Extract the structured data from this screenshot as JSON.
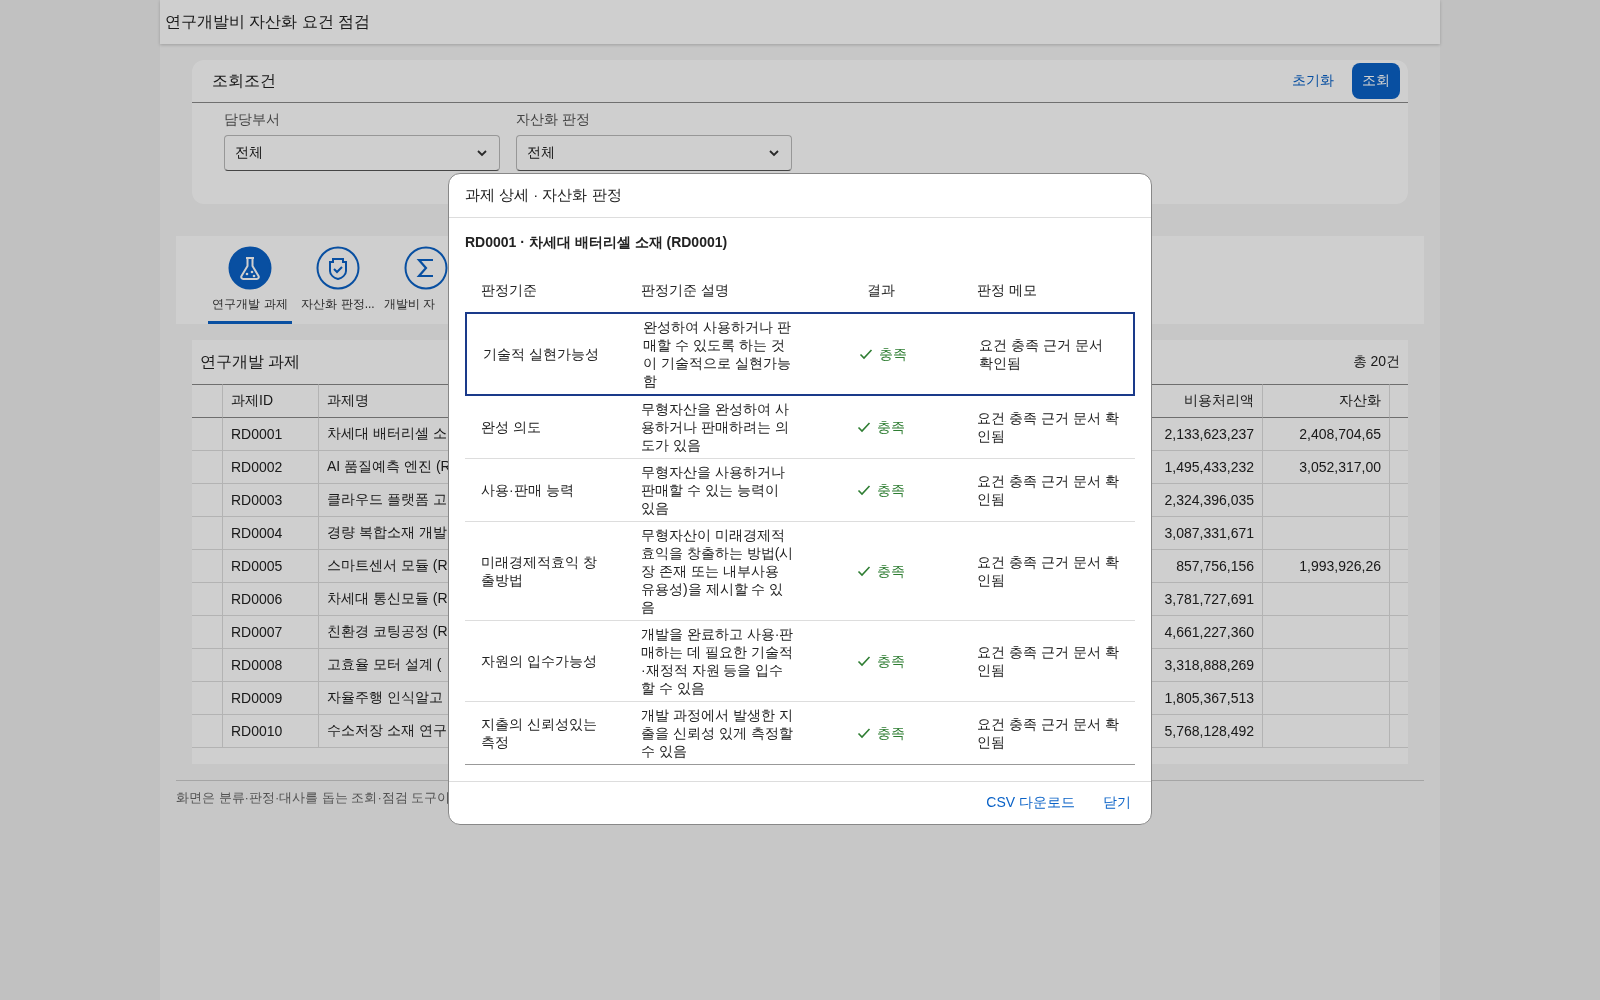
{
  "app": {
    "title": "연구개발비 자산화 요건 점검"
  },
  "filters": {
    "title": "조회조건",
    "reset_button": "초기화",
    "search_button": "조회",
    "fields": [
      {
        "label": "담당부서",
        "value": "전체"
      },
      {
        "label": "자산화 판정",
        "value": "전체"
      }
    ]
  },
  "tabs": [
    {
      "label": "연구개발 과제",
      "kind": "flask",
      "selected": true
    },
    {
      "label": "자산화 판정...",
      "kind": "shield",
      "selected": false
    },
    {
      "label": "개발비 자",
      "kind": "sigma",
      "selected": false
    }
  ],
  "project_table": {
    "title": "연구개발 과제",
    "count": "총 20건",
    "columns": [
      "과제ID",
      "과제명",
      "비용처리액",
      "자산화"
    ],
    "rows": [
      {
        "id": "RD0001",
        "name": "차세대 배터리셀 소",
        "expense": "2,133,623,237",
        "capitalized": "2,408,704,65"
      },
      {
        "id": "RD0002",
        "name": "AI 품질예측 엔진 (R",
        "expense": "1,495,433,232",
        "capitalized": "3,052,317,00"
      },
      {
        "id": "RD0003",
        "name": "클라우드 플랫폼 고",
        "expense": "2,324,396,035",
        "capitalized": ""
      },
      {
        "id": "RD0004",
        "name": "경량 복합소재 개발",
        "expense": "3,087,331,671",
        "capitalized": ""
      },
      {
        "id": "RD0005",
        "name": "스마트센서 모듈 (R",
        "expense": "857,756,156",
        "capitalized": "1,993,926,26"
      },
      {
        "id": "RD0006",
        "name": "차세대 통신모듈 (R",
        "expense": "3,781,727,691",
        "capitalized": ""
      },
      {
        "id": "RD0007",
        "name": "친환경 코팅공정 (R",
        "expense": "4,661,227,360",
        "capitalized": ""
      },
      {
        "id": "RD0008",
        "name": "고효율 모터 설계 (",
        "expense": "3,318,888,269",
        "capitalized": ""
      },
      {
        "id": "RD0009",
        "name": "자율주행 인식알고",
        "expense": "1,805,367,513",
        "capitalized": ""
      },
      {
        "id": "RD0010",
        "name": "수소저장 소재 연구",
        "expense": "5,768,128,492",
        "capitalized": ""
      }
    ]
  },
  "footer_note": "화면은 분류·판정·대사를 돕는 조회·점검 도구이",
  "dialog": {
    "title": "과제 상세 · 자산화 판정",
    "subtitle": "RD0001 · 차세대 배터리셀 소재 (RD0001)",
    "columns": [
      "판정기준",
      "판정기준 설명",
      "결과",
      "판정 메모"
    ],
    "rows": [
      {
        "criterion": "기술적 실현가능성",
        "description": "완성하여 사용하거나 판매할 수 있도록 하는 것이 기술적으로 실현가능함",
        "result": "충족",
        "memo": "요건 충족 근거 문서 확인됨",
        "selected": true
      },
      {
        "criterion": "완성 의도",
        "description": "무형자산을 완성하여 사용하거나 판매하려는 의도가 있음",
        "result": "충족",
        "memo": "요건 충족 근거 문서 확인됨",
        "selected": false
      },
      {
        "criterion": "사용·판매 능력",
        "description": "무형자산을 사용하거나 판매할 수 있는 능력이 있음",
        "result": "충족",
        "memo": "요건 충족 근거 문서 확인됨",
        "selected": false
      },
      {
        "criterion": "미래경제적효익 창출방법",
        "description": "무형자산이 미래경제적 효익을 창출하는 방법(시장 존재 또는 내부사용 유용성)을 제시할 수 있음",
        "result": "충족",
        "memo": "요건 충족 근거 문서 확인됨",
        "selected": false
      },
      {
        "criterion": "자원의 입수가능성",
        "description": "개발을 완료하고 사용·판매하는 데 필요한 기술적·재정적 자원 등을 입수할 수 있음",
        "result": "충족",
        "memo": "요건 충족 근거 문서 확인됨",
        "selected": false
      },
      {
        "criterion": "지출의 신뢰성있는 측정",
        "description": "개발 과정에서 발생한 지출을 신뢰성 있게 측정할 수 있음",
        "result": "충족",
        "memo": "요건 충족 근거 문서 확인됨",
        "selected": false
      }
    ],
    "buttons": [
      "CSV 다운로드",
      "닫기"
    ]
  }
}
